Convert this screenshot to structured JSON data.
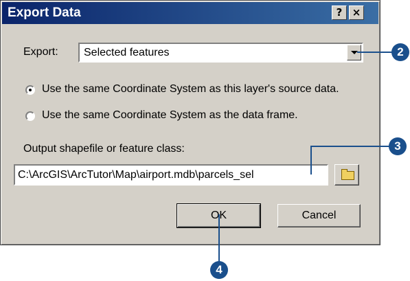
{
  "window": {
    "title": "Export Data",
    "help_label": "?",
    "close_label": "×"
  },
  "export": {
    "label": "Export:",
    "selected": "Selected features"
  },
  "coordinate": {
    "options": [
      {
        "label": "Use the same Coordinate System as this layer's source data.",
        "selected": true
      },
      {
        "label": "Use the same Coordinate System as the data frame.",
        "selected": false
      }
    ]
  },
  "output": {
    "label": "Output shapefile or feature class:",
    "value": "C:\\ArcGIS\\ArcTutor\\Map\\airport.mdb\\parcels_sel"
  },
  "buttons": {
    "ok": "OK",
    "cancel": "Cancel"
  },
  "callouts": {
    "c2": "2",
    "c3": "3",
    "c4": "4"
  },
  "colors": {
    "titlebar": "#0a246a",
    "callout": "#1a4f8c",
    "dialog_face": "#d4d0c8"
  }
}
